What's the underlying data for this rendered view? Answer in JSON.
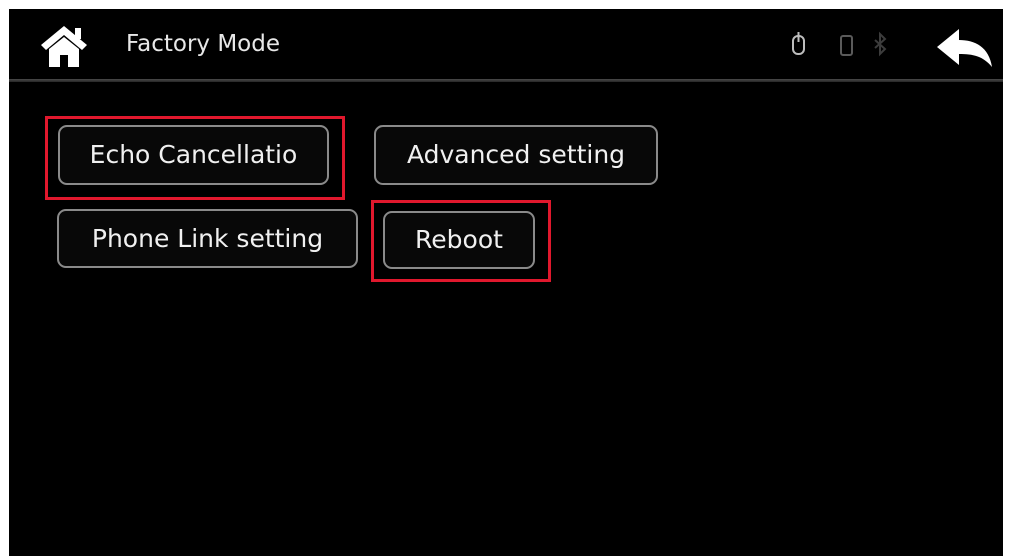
{
  "header": {
    "title": "Factory Mode",
    "home_icon": "home-icon",
    "back_icon": "back-arrow-icon",
    "status_icons": [
      "usb-icon",
      "phone-icon",
      "bluetooth-icon"
    ]
  },
  "buttons": {
    "echo_cancellation": "Echo Cancellatio",
    "advanced_setting": "Advanced setting",
    "phone_link_setting": "Phone Link setting",
    "reboot": "Reboot"
  },
  "colors": {
    "background": "#000000",
    "text": "#f0f0f0",
    "button_border": "#8a8a8a",
    "highlight": "#e0182d"
  }
}
